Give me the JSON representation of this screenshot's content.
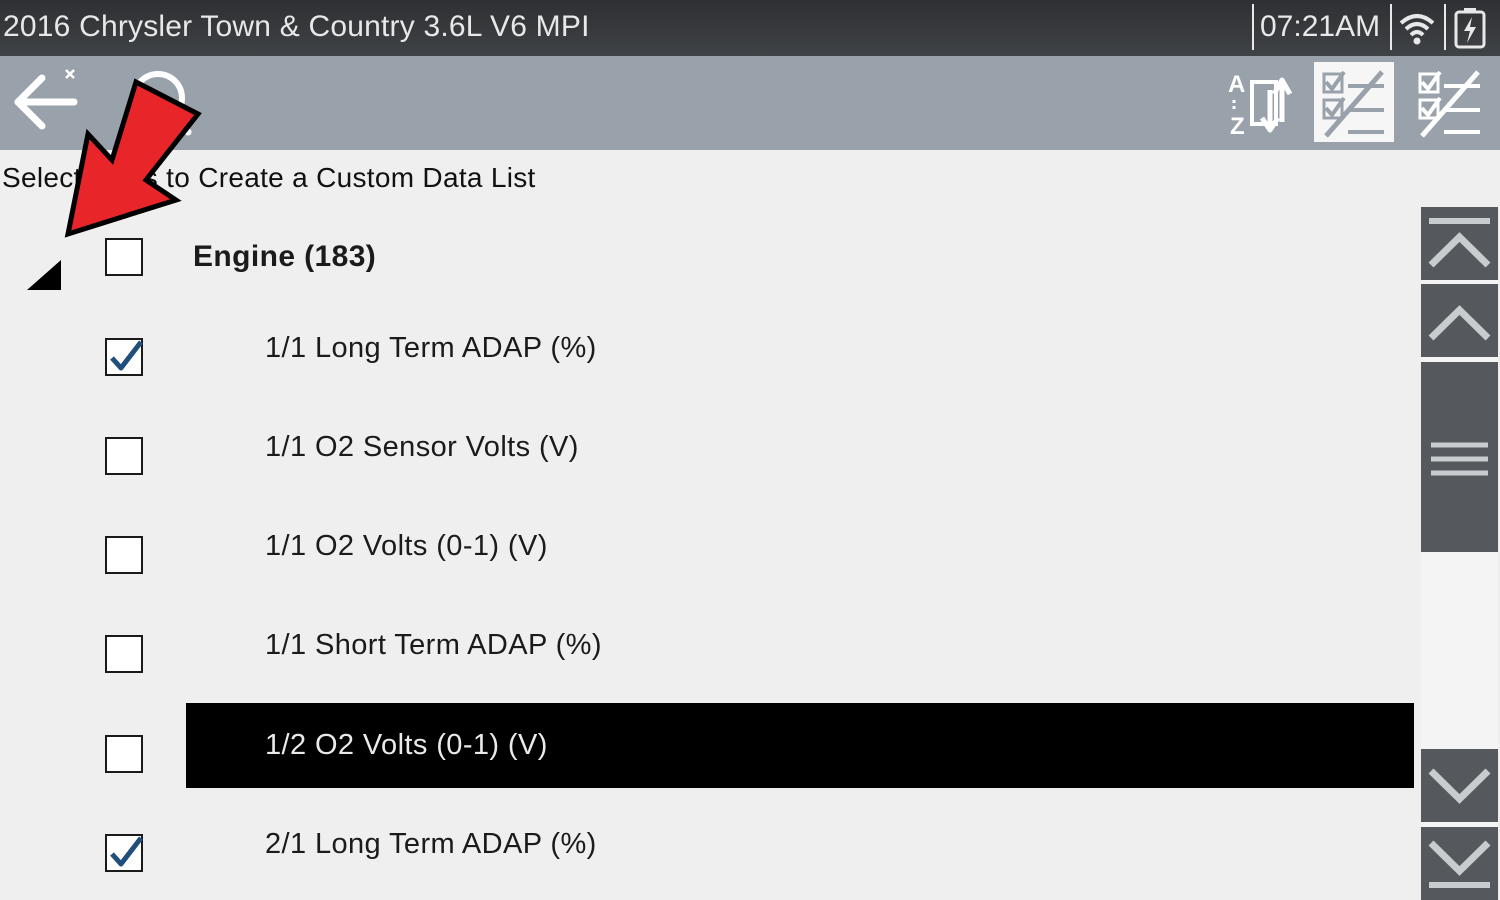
{
  "status_bar": {
    "vehicle_title": "2016 Chrysler Town & Country 3.6L V6 MPI",
    "time": "07:21AM",
    "icons": [
      "wifi-icon",
      "battery-charging-icon"
    ]
  },
  "toolbar": {
    "buttons": [
      {
        "name": "back-button",
        "icon": "back-arrow-icon"
      },
      {
        "name": "search-button",
        "icon": "search-icon"
      },
      {
        "name": "sort-button",
        "icon": "sort-a-z-icon"
      },
      {
        "name": "select-all-button",
        "icon": "select-all-icon",
        "active": true
      },
      {
        "name": "deselect-all-button",
        "icon": "deselect-all-icon"
      }
    ]
  },
  "instruction_text": "Select items to Create a Custom Data List",
  "group": {
    "label": "Engine (183)",
    "expanded": true,
    "checked": false
  },
  "items": [
    {
      "label": "1/1 Long Term ADAP (%)",
      "checked": true,
      "selected": false
    },
    {
      "label": "1/1 O2 Sensor Volts (V)",
      "checked": false,
      "selected": false
    },
    {
      "label": "1/1 O2 Volts (0-1) (V)",
      "checked": false,
      "selected": false
    },
    {
      "label": "1/1 Short Term ADAP (%)",
      "checked": false,
      "selected": false
    },
    {
      "label": "1/2 O2 Volts (0-1) (V)",
      "checked": false,
      "selected": true
    },
    {
      "label": "2/1 Long Term ADAP (%)",
      "checked": true,
      "selected": false
    }
  ],
  "scrollbar": {
    "controls": [
      "scroll-to-top-icon",
      "scroll-up-icon",
      "scroll-thumb-grip-icon",
      "scroll-down-icon",
      "scroll-to-bottom-icon"
    ]
  },
  "colors": {
    "status_bar": "#3a3c40",
    "toolbar": "#99a1ab",
    "background": "#efefef",
    "selection": "#000000",
    "checkmark": "#1f4f7a",
    "annotation_arrow": "#e8262a"
  }
}
